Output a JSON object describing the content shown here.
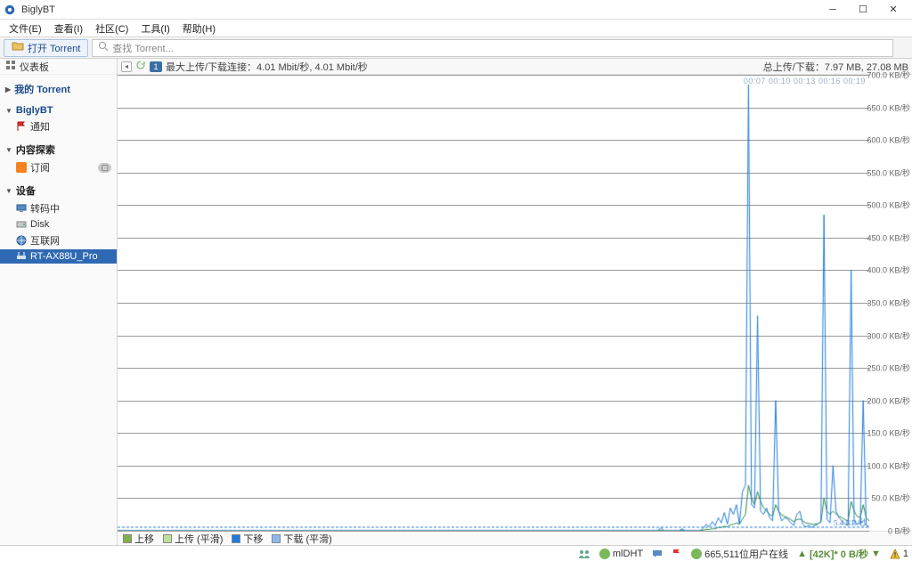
{
  "window": {
    "title": "BiglyBT"
  },
  "menu": [
    "文件(E)",
    "查看(I)",
    "社区(C)",
    "工具(I)",
    "帮助(H)"
  ],
  "toolbar": {
    "open_label": "打开 Torrent",
    "search_placeholder": "查找 Torrent..."
  },
  "sidebar": {
    "dashboard": "仪表板",
    "sections": [
      {
        "title": "我的 Torrent",
        "color": "blue",
        "items": []
      },
      {
        "title": "BiglyBT",
        "color": "blue",
        "items": [
          {
            "icon": "flag-icon",
            "label": "通知"
          }
        ]
      },
      {
        "title": "内容探索",
        "color": "black",
        "items": [
          {
            "icon": "rss-icon",
            "label": "订阅",
            "pill": "▢"
          }
        ]
      },
      {
        "title": "设备",
        "color": "black",
        "items": [
          {
            "icon": "screen-icon",
            "label": "转码中"
          },
          {
            "icon": "disk-icon",
            "label": "Disk"
          },
          {
            "icon": "globe-icon",
            "label": "互联网"
          },
          {
            "icon": "router-icon",
            "label": "RT-AX88U_Pro",
            "selected": true
          }
        ]
      }
    ]
  },
  "strip": {
    "badge": "1",
    "left_text": "最大上传/下载连接：4.01 Mbit/秒, 4.01 Mbit/秒",
    "right_text": "总上传/下载：7.97 MB, 27.08 MB"
  },
  "chart_data": {
    "type": "line",
    "ylabel_unit": "KB/秒",
    "ylabels": [
      "700.0 KB/秒",
      "650.0 KB/秒",
      "600.0 KB/秒",
      "550.0 KB/秒",
      "500.0 KB/秒",
      "450.0 KB/秒",
      "400.0 KB/秒",
      "350.0 KB/秒",
      "300.0 KB/秒",
      "250.0 KB/秒",
      "200.0 KB/秒",
      "150.0 KB/秒",
      "100.0 KB/秒",
      "50.0 KB/秒",
      "0 B/秒"
    ],
    "ylim": [
      0,
      700
    ],
    "time_hint": "00:07  00:10  00:13  00:16  00:19",
    "baseline_label": "5.4 KB/秒",
    "series": [
      {
        "name": "下载",
        "color": "#1f7be0",
        "values": [
          0,
          0,
          0,
          0,
          0,
          0,
          0,
          0,
          0,
          0,
          0,
          0,
          0,
          0,
          0,
          0,
          0,
          0,
          0,
          0,
          0,
          0,
          0,
          0,
          0,
          0,
          0,
          0,
          0,
          0,
          0,
          0,
          0,
          0,
          0,
          0,
          0,
          0,
          0,
          0,
          0,
          0,
          0,
          0,
          0,
          0,
          0,
          0,
          0,
          0,
          0,
          0,
          0,
          0,
          0,
          0,
          0,
          0,
          0,
          0,
          0,
          0,
          0,
          0,
          0,
          0,
          0,
          0,
          0,
          0,
          0,
          0,
          0,
          0,
          0,
          0,
          0,
          0,
          0,
          0,
          0,
          0,
          0,
          0,
          0,
          0,
          0,
          0,
          0,
          0,
          0,
          0,
          0,
          0,
          0,
          0,
          0,
          0,
          0,
          0,
          0,
          0,
          0,
          0,
          0,
          0,
          0,
          0,
          0,
          0,
          0,
          0,
          0,
          0,
          0,
          0,
          0,
          0,
          0,
          0,
          0,
          0,
          0,
          0,
          0,
          0,
          0,
          0,
          0,
          0,
          0,
          0,
          0,
          0,
          0,
          0,
          0,
          0,
          0,
          0,
          0,
          0,
          0,
          0,
          0,
          0,
          0,
          0,
          0,
          0,
          0,
          0,
          0,
          0,
          0,
          0,
          0,
          0,
          0,
          0,
          0,
          0,
          0,
          0,
          0,
          0,
          0,
          0,
          0,
          0,
          0,
          0,
          0,
          0,
          0,
          0,
          0,
          0,
          0,
          0,
          5,
          0,
          0,
          0,
          0,
          0,
          0,
          3,
          0,
          0,
          0,
          0,
          0,
          0,
          4,
          10,
          6,
          14,
          8,
          20,
          12,
          28,
          10,
          35,
          25,
          40,
          10,
          60,
          70,
          685,
          40,
          35,
          330,
          30,
          25,
          35,
          20,
          15,
          200,
          30,
          15,
          20,
          18,
          12,
          8,
          25,
          30,
          10,
          6,
          8,
          5,
          8,
          10,
          15,
          485,
          18,
          12,
          100,
          30,
          20,
          15,
          10,
          8,
          400,
          15,
          10,
          12,
          200,
          8,
          6
        ]
      },
      {
        "name": "下载 (平滑)",
        "color": "#2a8c3b",
        "values": [
          0,
          0,
          0,
          0,
          0,
          0,
          0,
          0,
          0,
          0,
          0,
          0,
          0,
          0,
          0,
          0,
          0,
          0,
          0,
          0,
          0,
          0,
          0,
          0,
          0,
          0,
          0,
          0,
          0,
          0,
          0,
          0,
          0,
          0,
          0,
          0,
          0,
          0,
          0,
          0,
          0,
          0,
          0,
          0,
          0,
          0,
          0,
          0,
          0,
          0,
          0,
          0,
          0,
          0,
          0,
          0,
          0,
          0,
          0,
          0,
          0,
          0,
          0,
          0,
          0,
          0,
          0,
          0,
          0,
          0,
          0,
          0,
          0,
          0,
          0,
          0,
          0,
          0,
          0,
          0,
          0,
          0,
          0,
          0,
          0,
          0,
          0,
          0,
          0,
          0,
          0,
          0,
          0,
          0,
          0,
          0,
          0,
          0,
          0,
          0,
          0,
          0,
          0,
          0,
          0,
          0,
          0,
          0,
          0,
          0,
          0,
          0,
          0,
          0,
          0,
          0,
          0,
          0,
          0,
          0,
          0,
          0,
          0,
          0,
          0,
          0,
          0,
          0,
          0,
          0,
          0,
          0,
          0,
          0,
          0,
          0,
          0,
          0,
          0,
          0,
          0,
          0,
          0,
          0,
          0,
          0,
          0,
          0,
          0,
          0,
          0,
          0,
          0,
          0,
          0,
          0,
          0,
          0,
          0,
          0,
          0,
          0,
          0,
          0,
          0,
          0,
          0,
          0,
          0,
          0,
          0,
          0,
          0,
          0,
          0,
          0,
          0,
          0,
          0,
          0,
          1,
          0,
          0,
          0,
          0,
          0,
          0,
          1,
          0,
          0,
          0,
          0,
          0,
          0,
          1,
          2,
          2,
          3,
          3,
          5,
          5,
          7,
          6,
          9,
          10,
          12,
          10,
          18,
          25,
          70,
          50,
          40,
          60,
          45,
          35,
          30,
          25,
          22,
          40,
          30,
          24,
          22,
          20,
          17,
          14,
          17,
          18,
          15,
          12,
          11,
          10,
          10,
          11,
          13,
          50,
          30,
          25,
          30,
          26,
          22,
          20,
          17,
          15,
          45,
          30,
          22,
          20,
          40,
          20,
          15
        ]
      },
      {
        "name": "上传",
        "color": "#7fb24a",
        "values": []
      },
      {
        "name": "上传 (平滑)",
        "color": "#bde09a",
        "values": []
      }
    ],
    "legend": [
      {
        "label": "上移",
        "color": "#7fb24a"
      },
      {
        "label": "上传 (平滑)",
        "color": "#bde09a"
      },
      {
        "label": "下移",
        "color": "#1f7be0"
      },
      {
        "label": "下载 (平滑)",
        "color": "#8db9ee"
      }
    ]
  },
  "status": {
    "friends_icon": "friends-icon",
    "mldht": "mlDHT",
    "chat_icon": "chat-icon",
    "flag_icon": "flag-icon",
    "users": "665,511位用户在线",
    "level_icon": "level-icon",
    "speed": "[42K]* 0 B/秒",
    "warn": "1"
  }
}
